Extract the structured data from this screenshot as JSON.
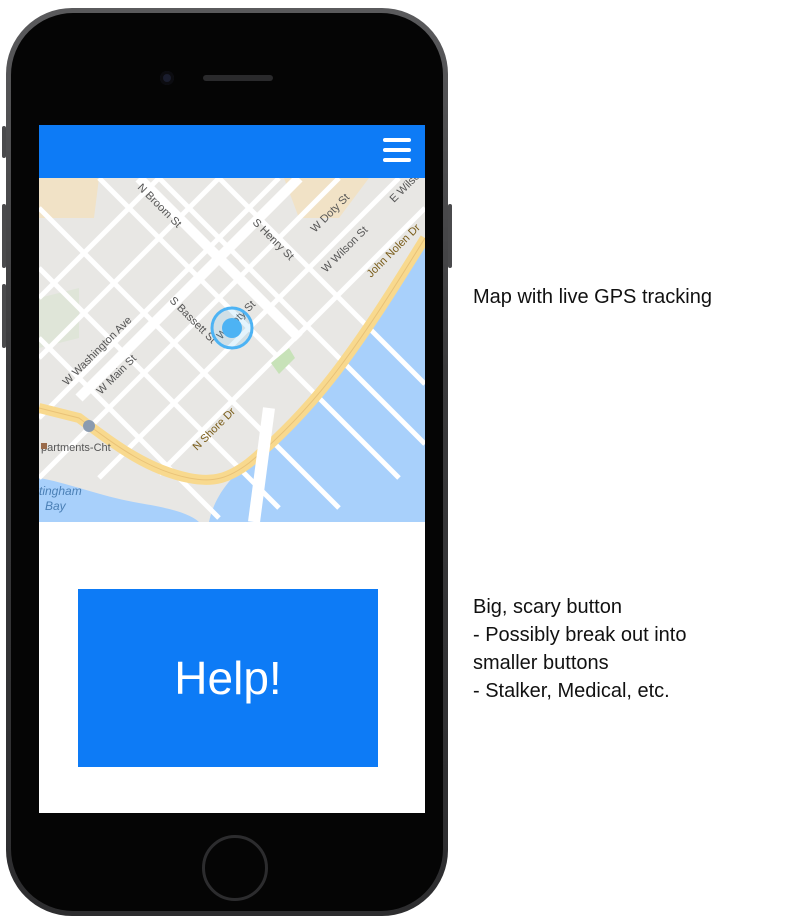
{
  "map": {
    "streets": [
      "N Broom St",
      "S Henry St",
      "W Doty St",
      "W Wilson St",
      "E Wilso",
      "John Nolen Dr",
      "S Bassett St",
      "W Doty St",
      "W Washington Ave",
      "W Main St",
      "N Shore Dr"
    ],
    "places": [
      "partments-Cht",
      "tingham",
      "Bay"
    ],
    "water_color": "#a8d0fb",
    "location_color": "#4db3f4"
  },
  "help_button": {
    "label": "Help!"
  },
  "annotations": {
    "map_note": "Map with live GPS tracking",
    "button_note": [
      "Big, scary button",
      "- Possibly break out into",
      "smaller buttons",
      "- Stalker, Medical, etc."
    ]
  },
  "colors": {
    "accent": "#0d7bf6"
  }
}
